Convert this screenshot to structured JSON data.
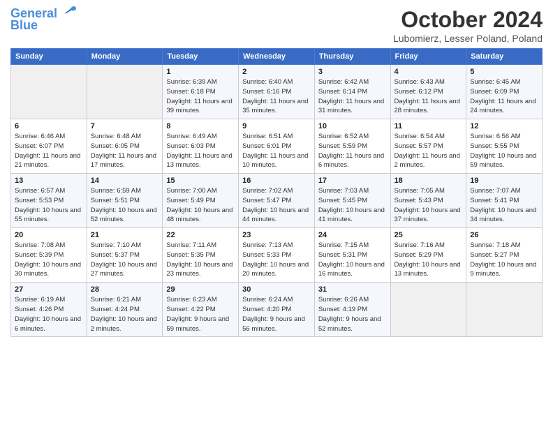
{
  "header": {
    "logo_line1": "General",
    "logo_line2": "Blue",
    "month_title": "October 2024",
    "location": "Lubomierz, Lesser Poland, Poland"
  },
  "weekdays": [
    "Sunday",
    "Monday",
    "Tuesday",
    "Wednesday",
    "Thursday",
    "Friday",
    "Saturday"
  ],
  "weeks": [
    [
      {
        "day": "",
        "info": ""
      },
      {
        "day": "",
        "info": ""
      },
      {
        "day": "1",
        "info": "Sunrise: 6:39 AM\nSunset: 6:18 PM\nDaylight: 11 hours and 39 minutes."
      },
      {
        "day": "2",
        "info": "Sunrise: 6:40 AM\nSunset: 6:16 PM\nDaylight: 11 hours and 35 minutes."
      },
      {
        "day": "3",
        "info": "Sunrise: 6:42 AM\nSunset: 6:14 PM\nDaylight: 11 hours and 31 minutes."
      },
      {
        "day": "4",
        "info": "Sunrise: 6:43 AM\nSunset: 6:12 PM\nDaylight: 11 hours and 28 minutes."
      },
      {
        "day": "5",
        "info": "Sunrise: 6:45 AM\nSunset: 6:09 PM\nDaylight: 11 hours and 24 minutes."
      }
    ],
    [
      {
        "day": "6",
        "info": "Sunrise: 6:46 AM\nSunset: 6:07 PM\nDaylight: 11 hours and 21 minutes."
      },
      {
        "day": "7",
        "info": "Sunrise: 6:48 AM\nSunset: 6:05 PM\nDaylight: 11 hours and 17 minutes."
      },
      {
        "day": "8",
        "info": "Sunrise: 6:49 AM\nSunset: 6:03 PM\nDaylight: 11 hours and 13 minutes."
      },
      {
        "day": "9",
        "info": "Sunrise: 6:51 AM\nSunset: 6:01 PM\nDaylight: 11 hours and 10 minutes."
      },
      {
        "day": "10",
        "info": "Sunrise: 6:52 AM\nSunset: 5:59 PM\nDaylight: 11 hours and 6 minutes."
      },
      {
        "day": "11",
        "info": "Sunrise: 6:54 AM\nSunset: 5:57 PM\nDaylight: 11 hours and 2 minutes."
      },
      {
        "day": "12",
        "info": "Sunrise: 6:56 AM\nSunset: 5:55 PM\nDaylight: 10 hours and 59 minutes."
      }
    ],
    [
      {
        "day": "13",
        "info": "Sunrise: 6:57 AM\nSunset: 5:53 PM\nDaylight: 10 hours and 55 minutes."
      },
      {
        "day": "14",
        "info": "Sunrise: 6:59 AM\nSunset: 5:51 PM\nDaylight: 10 hours and 52 minutes."
      },
      {
        "day": "15",
        "info": "Sunrise: 7:00 AM\nSunset: 5:49 PM\nDaylight: 10 hours and 48 minutes."
      },
      {
        "day": "16",
        "info": "Sunrise: 7:02 AM\nSunset: 5:47 PM\nDaylight: 10 hours and 44 minutes."
      },
      {
        "day": "17",
        "info": "Sunrise: 7:03 AM\nSunset: 5:45 PM\nDaylight: 10 hours and 41 minutes."
      },
      {
        "day": "18",
        "info": "Sunrise: 7:05 AM\nSunset: 5:43 PM\nDaylight: 10 hours and 37 minutes."
      },
      {
        "day": "19",
        "info": "Sunrise: 7:07 AM\nSunset: 5:41 PM\nDaylight: 10 hours and 34 minutes."
      }
    ],
    [
      {
        "day": "20",
        "info": "Sunrise: 7:08 AM\nSunset: 5:39 PM\nDaylight: 10 hours and 30 minutes."
      },
      {
        "day": "21",
        "info": "Sunrise: 7:10 AM\nSunset: 5:37 PM\nDaylight: 10 hours and 27 minutes."
      },
      {
        "day": "22",
        "info": "Sunrise: 7:11 AM\nSunset: 5:35 PM\nDaylight: 10 hours and 23 minutes."
      },
      {
        "day": "23",
        "info": "Sunrise: 7:13 AM\nSunset: 5:33 PM\nDaylight: 10 hours and 20 minutes."
      },
      {
        "day": "24",
        "info": "Sunrise: 7:15 AM\nSunset: 5:31 PM\nDaylight: 10 hours and 16 minutes."
      },
      {
        "day": "25",
        "info": "Sunrise: 7:16 AM\nSunset: 5:29 PM\nDaylight: 10 hours and 13 minutes."
      },
      {
        "day": "26",
        "info": "Sunrise: 7:18 AM\nSunset: 5:27 PM\nDaylight: 10 hours and 9 minutes."
      }
    ],
    [
      {
        "day": "27",
        "info": "Sunrise: 6:19 AM\nSunset: 4:26 PM\nDaylight: 10 hours and 6 minutes."
      },
      {
        "day": "28",
        "info": "Sunrise: 6:21 AM\nSunset: 4:24 PM\nDaylight: 10 hours and 2 minutes."
      },
      {
        "day": "29",
        "info": "Sunrise: 6:23 AM\nSunset: 4:22 PM\nDaylight: 9 hours and 59 minutes."
      },
      {
        "day": "30",
        "info": "Sunrise: 6:24 AM\nSunset: 4:20 PM\nDaylight: 9 hours and 56 minutes."
      },
      {
        "day": "31",
        "info": "Sunrise: 6:26 AM\nSunset: 4:19 PM\nDaylight: 9 hours and 52 minutes."
      },
      {
        "day": "",
        "info": ""
      },
      {
        "day": "",
        "info": ""
      }
    ]
  ]
}
